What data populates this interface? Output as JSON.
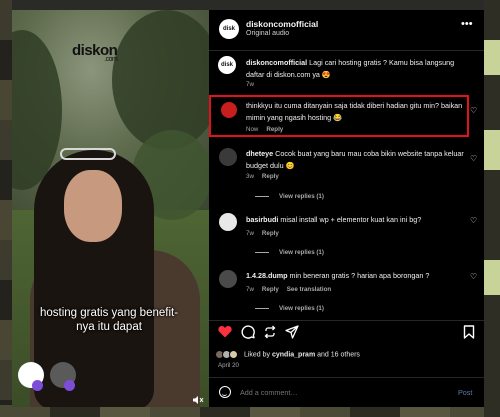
{
  "post": {
    "author": "diskoncomofficial",
    "audio": "Original audio",
    "more_icon": "ellipsis-icon"
  },
  "video": {
    "brand": "diskon",
    "brand_domain": ".com",
    "caption_line1": "hosting gratis yang benefit-",
    "caption_line2": "nya itu dapat",
    "mute_icon": "speaker-muted-icon"
  },
  "comments": [
    {
      "user": "diskoncomofficial",
      "text": "Lagi cari hosting gratis ? Kamu bisa langsung daftar di diskon.com ya 😍",
      "time": "7w",
      "actions": []
    },
    {
      "user": "",
      "text": "thinkkyu itu cuma ditanyain saja tidak diberi hadian gitu min? baikan mimin yang ngasih hosting 😂",
      "time": "Now",
      "actions": [
        "Reply"
      ],
      "highlighted": true
    },
    {
      "user": "dheteye",
      "text": "Cocok buat yang baru mau coba bikin website tanpa keluar budget dulu 😊",
      "time": "3w",
      "actions": [
        "Reply"
      ],
      "replies": "View replies (1)"
    },
    {
      "user": "basirbudi",
      "text": "misal install wp + elementor kuat kan ini bg?",
      "time": "7w",
      "actions": [
        "Reply"
      ],
      "replies": "View replies (1)"
    },
    {
      "user": "1.4.28.dump",
      "text": "min beneran gratis ? harian apa borongan ?",
      "time": "7w",
      "actions": [
        "Reply",
        "See translation"
      ],
      "replies": "View replies (1)"
    }
  ],
  "footer": {
    "likes_prefix": "Liked by",
    "liked_user": "cyndia_pram",
    "likes_suffix": "and 16 others",
    "date": "April 20",
    "add_comment_placeholder": "Add a comment…",
    "post_label": "Post"
  },
  "icons": {
    "like": "heart-filled-icon",
    "comment": "comment-icon",
    "share": "repost-icon",
    "send": "send-icon",
    "save": "bookmark-icon"
  },
  "colors": {
    "highlight_border": "#e0131a",
    "liked_heart": "#ff3040",
    "post_button": "#5c7ba8",
    "panel_bg": "#000000"
  }
}
